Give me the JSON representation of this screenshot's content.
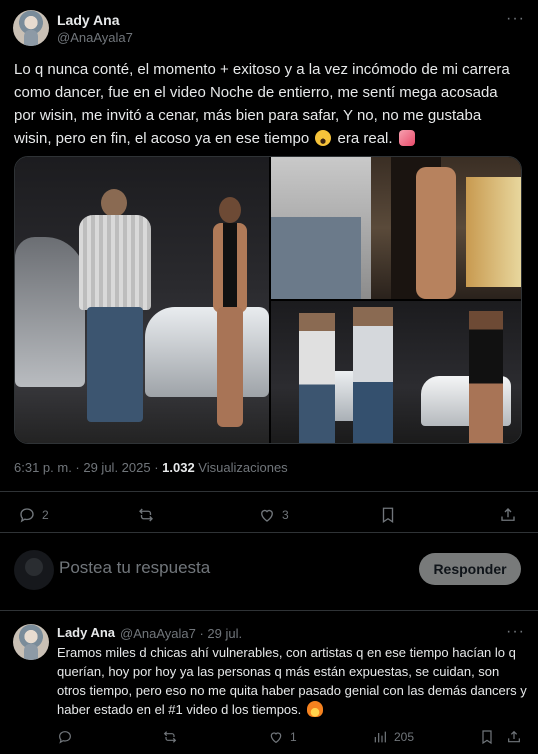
{
  "tweet": {
    "author_name": "Lady Ana",
    "author_handle": "@AnaAyala7",
    "text": "Lo q nunca conté, el momento + exitoso y a la vez incómodo de mi carrera como dancer, fue en el video Noche de entierro, me sentí mega acosada por wisin, me invitó a cenar, más bien para safar, Y no, no me gustaba wisin, pero en fin, el acoso ya en ese tiempo",
    "text_tail": "era real.",
    "emojis": [
      "astonished-face-emoji",
      "heart-emoji"
    ],
    "time": "6:31 p. m. · 29 jul. 2025 · ",
    "views_count": "1.032",
    "views_label": " Visualizaciones",
    "replies_count": "2",
    "retweets_count": "",
    "likes_count": "3"
  },
  "reply_box": {
    "placeholder": "Postea tu respuesta",
    "button_label": "Responder"
  },
  "reply": {
    "author_name": "Lady Ana",
    "author_handle": "@AnaAyala7 · 29 jul.",
    "text": "Eramos miles d chicas ahí vulnerables, con artistas q en ese tiempo hacían lo q querían, hoy por hoy ya las personas q más están expuestas, se cuidan, son otros tiempo, pero eso no me quita haber pasado genial con las demás dancers y haber estado en el #1 video d los tiempos.",
    "replies_count": "",
    "retweets_count": "",
    "likes_count": "1",
    "views_count": "205"
  },
  "icons": [
    "more-icon",
    "reply-icon",
    "retweet-icon",
    "like-icon",
    "bookmark-icon",
    "share-icon",
    "views-icon",
    "fire-emoji"
  ],
  "colors": {
    "background": "#000000",
    "text": "#e7e9ea",
    "muted": "#71767b",
    "divider": "#2f3336",
    "button": "#787a7a"
  }
}
